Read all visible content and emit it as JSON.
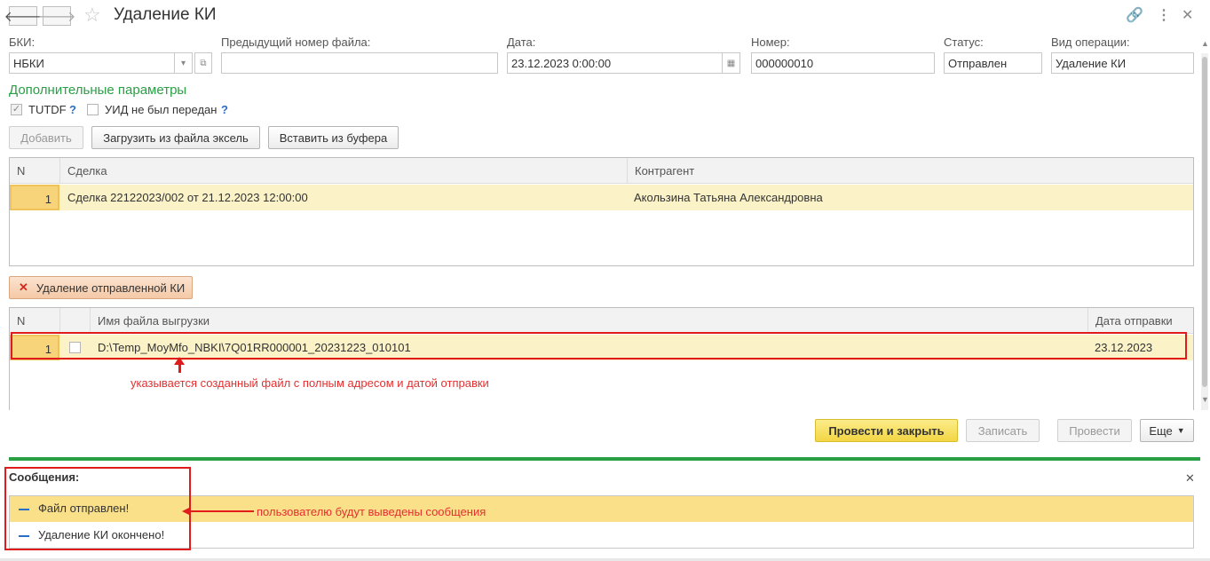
{
  "header": {
    "title": "Удаление КИ"
  },
  "fields": {
    "bki": {
      "label": "БКИ:",
      "value": "НБКИ"
    },
    "prev_file": {
      "label": "Предыдущий номер файла:",
      "value": ""
    },
    "date": {
      "label": "Дата:",
      "value": "23.12.2023  0:00:00"
    },
    "number": {
      "label": "Номер:",
      "value": "000000010"
    },
    "status": {
      "label": "Статус:",
      "value": "Отправлен"
    },
    "operation": {
      "label": "Вид операции:",
      "value": "Удаление КИ"
    }
  },
  "params": {
    "title": "Дополнительные параметры",
    "tutdf_label": "TUTDF",
    "uid_label": "УИД не был передан",
    "help": "?"
  },
  "toolbar": {
    "add": "Добавить",
    "load_excel": "Загрузить из файла эксель",
    "paste": "Вставить из буфера"
  },
  "deals_table": {
    "columns": [
      "N",
      "Сделка",
      "Контрагент"
    ],
    "rows": [
      {
        "n": "1",
        "deal": "Сделка 22122023/002 от 21.12.2023 12:00:00",
        "counterparty": "Акользина Татьяна  Александровна"
      }
    ]
  },
  "delete_button": "Удаление отправленной КИ",
  "files_table": {
    "columns": [
      "N",
      "",
      "Имя файла выгрузки",
      "Дата отправки"
    ],
    "rows": [
      {
        "n": "1",
        "file": "D:\\Temp_MoyMfo_NBKI\\7Q01RR000001_20231223_010101",
        "date": "23.12.2023"
      }
    ]
  },
  "annotations": {
    "file_note": "указывается созданный файл с полным адресом и датой отправки",
    "messages_note": "пользователю будут выведены сообщения"
  },
  "actions": {
    "post_close": "Провести и закрыть",
    "save": "Записать",
    "post": "Провести",
    "more": "Еще"
  },
  "messages": {
    "title": "Сообщения:",
    "items": [
      "Файл отправлен!",
      "Удаление КИ окончено!"
    ]
  },
  "colors": {
    "accent_green": "#2aa045",
    "highlight_row": "#fbf2c8",
    "annotation_red": "#e01b1b"
  }
}
